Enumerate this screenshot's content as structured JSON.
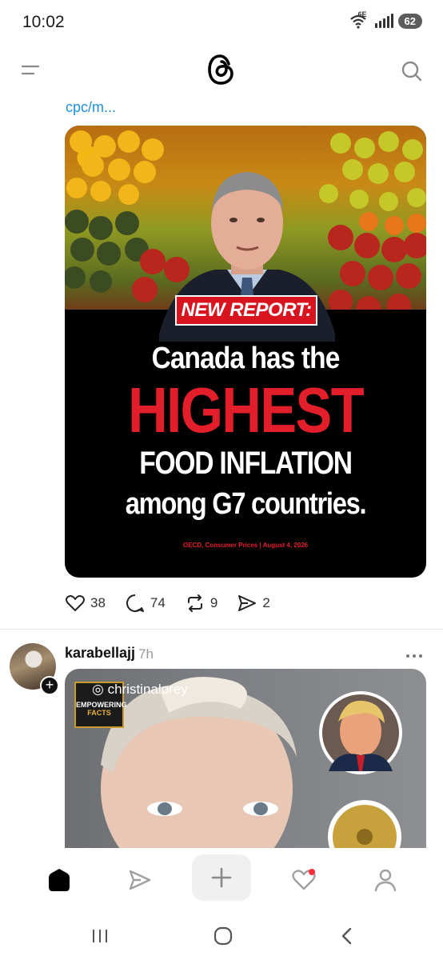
{
  "status": {
    "time": "10:02",
    "network_badge": "6E",
    "battery": "62"
  },
  "header": {
    "logo": "threads-logo",
    "menu_icon": "menu-icon",
    "search_icon": "search-icon"
  },
  "post1": {
    "link_text": "cpc/m...",
    "image": {
      "tag": "NEW REPORT:",
      "line1": "Canada has the",
      "line2": "HIGHEST",
      "line3": "FOOD INFLATION",
      "line4": "among G7 countries.",
      "source": "OECD, Consumer Prices | August 4, 2026"
    },
    "likes": "38",
    "comments": "74",
    "reposts": "9",
    "shares": "2"
  },
  "post2": {
    "username": "karabellajj",
    "time": "7h",
    "watermark_handle": "christinalorey",
    "badge_line1": "EMPOWERING",
    "badge_line2": "FACTS"
  },
  "colors": {
    "accent_red": "#e31e2b",
    "link_blue": "#1d8fd8",
    "notification_dot": "#ff2d3a"
  }
}
